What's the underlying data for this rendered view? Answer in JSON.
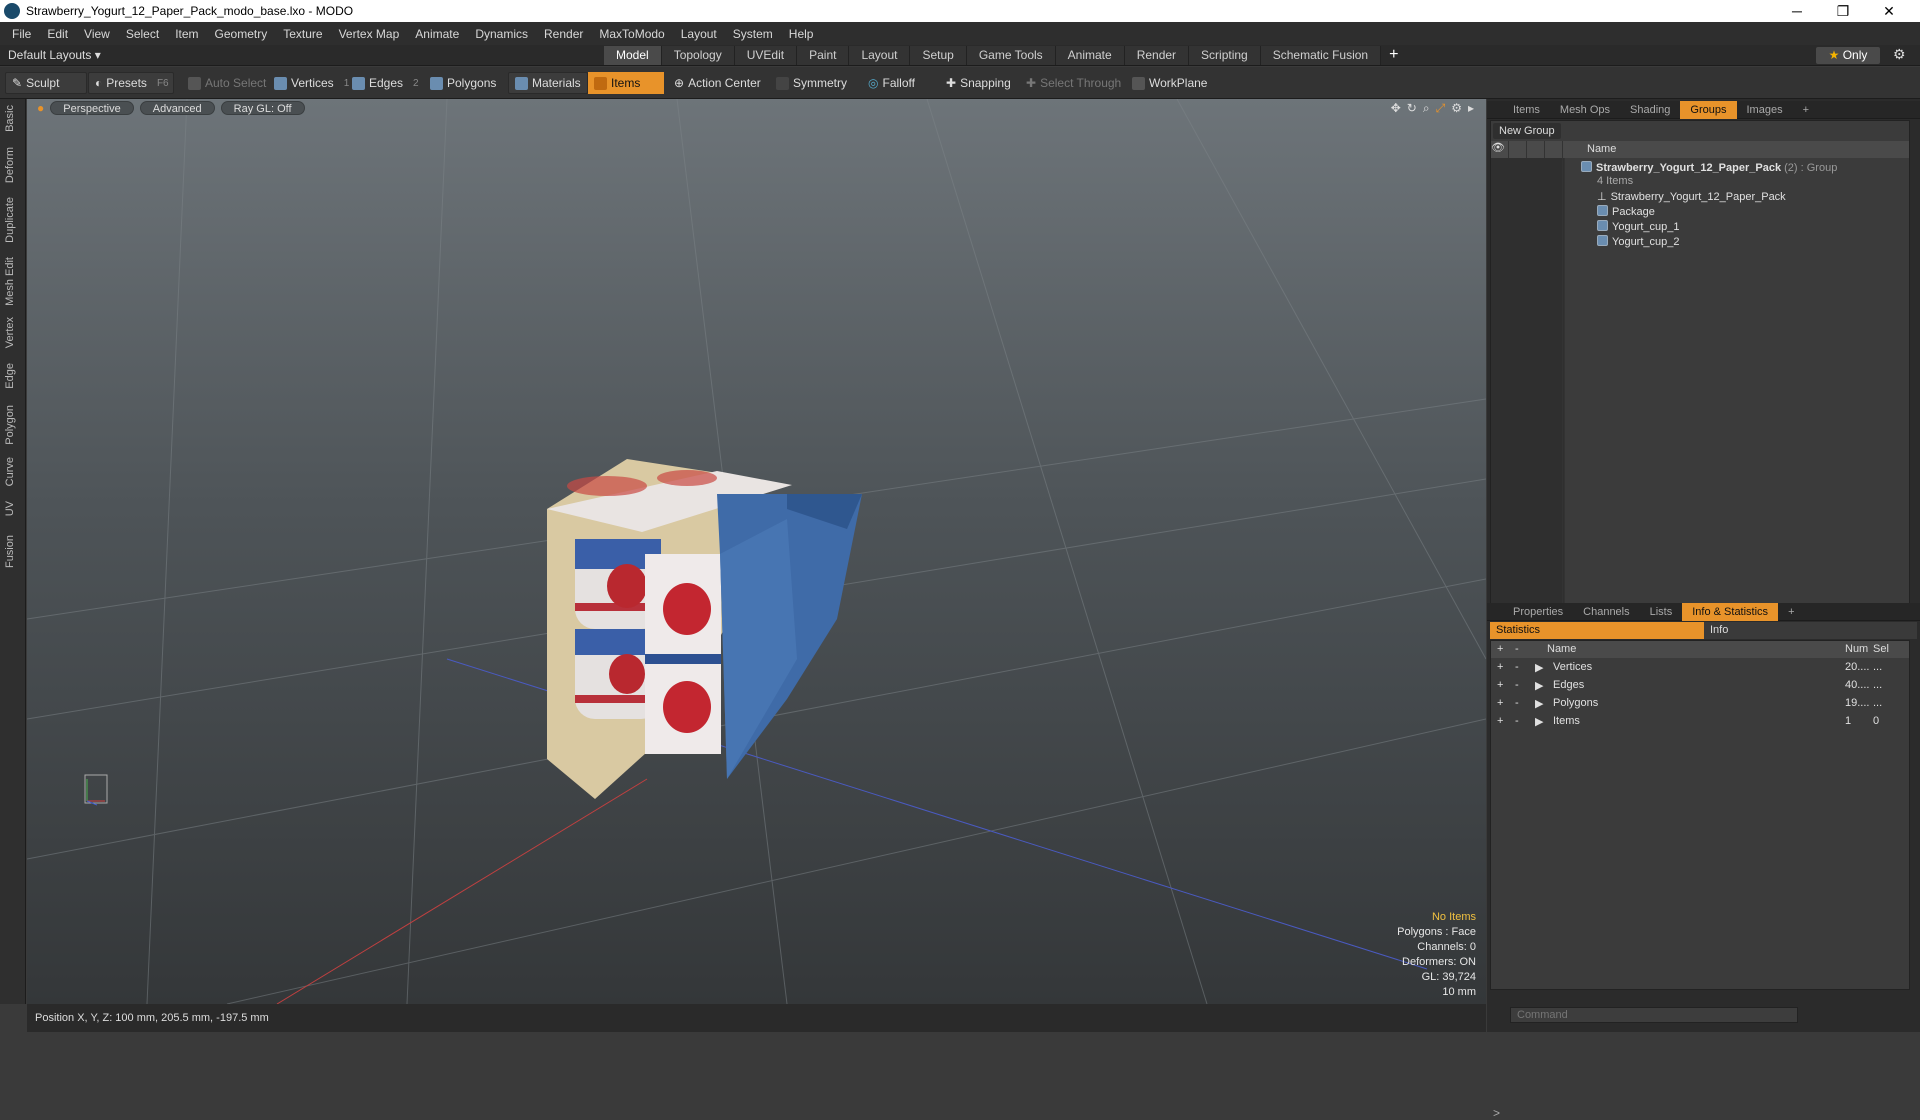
{
  "window": {
    "title": "Strawberry_Yogurt_12_Paper_Pack_modo_base.lxo - MODO",
    "minimize": "─",
    "maximize": "❐",
    "close": "✕"
  },
  "menu": [
    "File",
    "Edit",
    "View",
    "Select",
    "Item",
    "Geometry",
    "Texture",
    "Vertex Map",
    "Animate",
    "Dynamics",
    "Render",
    "MaxToModo",
    "Layout",
    "System",
    "Help"
  ],
  "layout": {
    "default_layouts": "Default Layouts ▾",
    "tabs": [
      "Model",
      "Topology",
      "UVEdit",
      "Paint",
      "Layout",
      "Setup",
      "Game Tools",
      "Animate",
      "Render",
      "Scripting",
      "Schematic Fusion"
    ],
    "active_tab": "Model",
    "plus": "+",
    "only": "Only",
    "star": "★"
  },
  "toolbar": {
    "sculpt": "Sculpt",
    "presets": "Presets",
    "presets_key": "F6",
    "auto_select": "Auto Select",
    "vertices": "Vertices",
    "vertices_num": "1",
    "edges": "Edges",
    "edges_num": "2",
    "polygons": "Polygons",
    "materials": "Materials",
    "items": "Items",
    "action_center": "Action Center",
    "symmetry": "Symmetry",
    "falloff": "Falloff",
    "snapping": "Snapping",
    "select_through": "Select Through",
    "workplane": "WorkPlane"
  },
  "left_tabs": [
    "Basic",
    "Deform",
    "Duplicate",
    "Mesh Edit",
    "Vertex",
    "Edge",
    "Polygon",
    "Curve",
    "UV",
    "Fusion"
  ],
  "viewport": {
    "view": "Perspective",
    "mode": "Advanced",
    "raygl": "Ray GL: Off",
    "info": {
      "no_items": "No Items",
      "polygons": "Polygons : Face",
      "channels": "Channels: 0",
      "deformers": "Deformers: ON",
      "gl": "GL: 39,724",
      "scale": "10 mm"
    }
  },
  "status": {
    "position": "Position X, Y, Z:  100 mm, 205.5 mm, -197.5 mm"
  },
  "top_panel": {
    "tabs": [
      "Items",
      "Mesh Ops",
      "Shading",
      "Groups",
      "Images"
    ],
    "active": "Groups",
    "plus": "+",
    "new_group": "New Group",
    "name_header": "Name",
    "group": {
      "name": "Strawberry_Yogurt_12_Paper_Pack",
      "suffix": "(2) : Group",
      "count": "4 Items"
    },
    "children": [
      "Strawberry_Yogurt_12_Paper_Pack",
      "Package",
      "Yogurt_cup_1",
      "Yogurt_cup_2"
    ]
  },
  "bottom_panel": {
    "tabs": [
      "Properties",
      "Channels",
      "Lists",
      "Info & Statistics"
    ],
    "active": "Info & Statistics",
    "plus": "+",
    "subtabs": [
      "Statistics",
      "Info"
    ],
    "headers": {
      "plus": "+",
      "minus": "-",
      "name": "Name",
      "num": "Num",
      "sel": "Sel"
    },
    "rows": [
      {
        "name": "Vertices",
        "num": "20....",
        "sel": "..."
      },
      {
        "name": "Edges",
        "num": "40....",
        "sel": "..."
      },
      {
        "name": "Polygons",
        "num": "19....",
        "sel": "..."
      },
      {
        "name": "Items",
        "num": "1",
        "sel": "0"
      }
    ]
  },
  "command": {
    "placeholder": "Command"
  },
  "colors": {
    "accent": "#e8932a",
    "panel": "#3b3b3b",
    "viewport_top": "#6d7479",
    "viewport_bottom": "#343739"
  }
}
